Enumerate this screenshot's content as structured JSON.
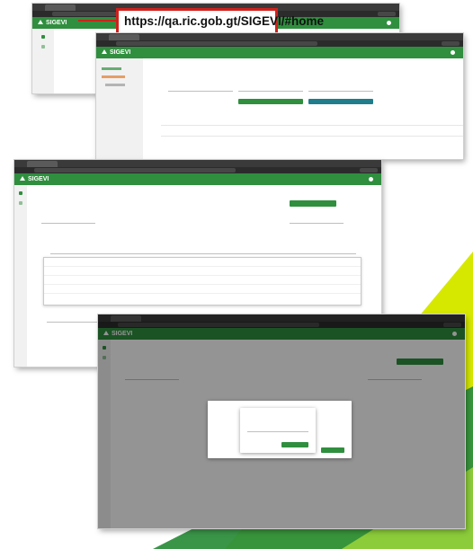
{
  "callout": {
    "url": "https://qa.ric.gob.gt/SIGEVI/#home"
  },
  "app": {
    "brand": "SIGEVI"
  },
  "colors": {
    "brand_green": "#2f8f3e",
    "accent_teal": "#1f7d8c",
    "callout_red": "#d0211c",
    "lime": "#d6e800"
  },
  "icons": [
    "sigevi-logo-icon",
    "user-avatar-icon",
    "search-icon",
    "delete-icon"
  ]
}
